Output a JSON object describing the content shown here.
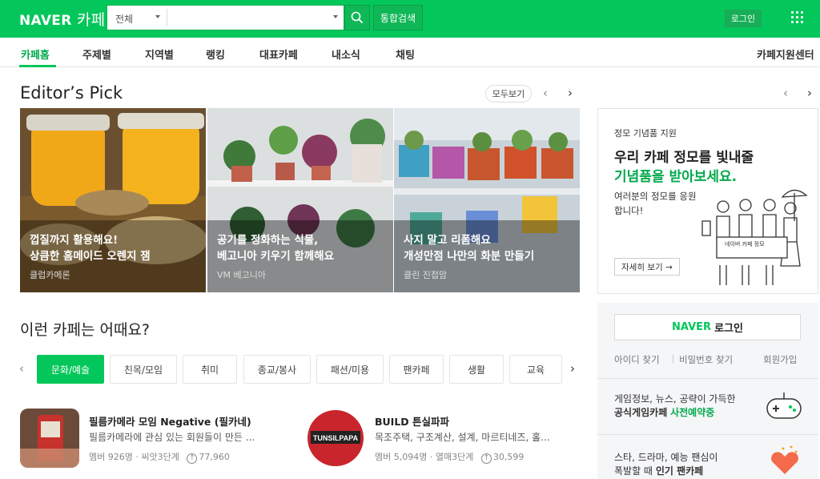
{
  "header": {
    "logo_naver": "NAVER",
    "logo_cafe": "카페",
    "search": {
      "category": "전체",
      "placeholder": ""
    },
    "integrated_search": "통합검색",
    "login": "로그인"
  },
  "nav": {
    "items": [
      "카페홈",
      "주제별",
      "지역별",
      "랭킹",
      "대표카페",
      "내소식",
      "채팅"
    ],
    "right": "카페지원센터"
  },
  "editors_pick": {
    "title": "Editor’s Pick",
    "view_all": "모두보기",
    "cards": [
      {
        "line1": "껍질까지 활용해요!",
        "line2": "상큼한 홈메이드 오렌지 잼",
        "cafe": "클럽카메론"
      },
      {
        "line1": "공기를 정화하는 식물,",
        "line2": "베고니아 키우기 함께해요",
        "cafe": "VM 베고니아"
      },
      {
        "line1": "사지 말고 리폼해요",
        "line2": "개성만점 나만의 화분 만들기",
        "cafe": "클린 진접맘"
      }
    ]
  },
  "promo": {
    "small": "정모 기념품 지원",
    "headline1": "우리 카페 정모를 빛내줄",
    "headline2": "기념품을 받아보세요.",
    "desc": "여러분의 정모를 응원합니다!",
    "more": "자세히 보기 →",
    "sign": "네이버 카페 정모"
  },
  "side": {
    "login_naver": "NAVER",
    "login_text": "로그인",
    "find_id": "아이디 찾기",
    "find_pw": "비밀번호 찾기",
    "join": "회원가입",
    "banner1_l1": "게임정보, 뉴스, 공략이 가득한",
    "banner1_l2a": "공식게임카페",
    "banner1_l2b": "사전예약중",
    "banner2_l1": "스타, 드라마, 예능 팬심이",
    "banner2_l2a": "폭발할 때",
    "banner2_l2b": "인기 팬카페"
  },
  "recommend": {
    "title": "이런 카페는 어때요?",
    "tabs": [
      "문화/예술",
      "친목/모임",
      "취미",
      "종교/봉사",
      "패션/미용",
      "팬카페",
      "생활",
      "교육"
    ],
    "cafes": [
      {
        "name": "필름카메라 모임 Negative (필카네)",
        "desc": "필름카메라에 관심 있는 회원들이 만든 ...",
        "members": "멤버 926명",
        "level": "씨앗3단계",
        "visits": "77,960"
      },
      {
        "name": "BUILD 튼실파파",
        "desc": "목조주택, 구조계산, 설계, 마르티네즈, 홀...",
        "members": "멤버 5,094명",
        "level": "열매3단계",
        "visits": "30,599"
      }
    ]
  },
  "colors": {
    "brand": "#03c75a",
    "text": "#222222"
  }
}
